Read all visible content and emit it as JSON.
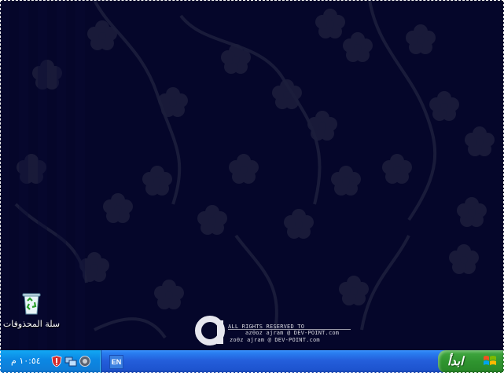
{
  "desktop": {
    "background_color": "#05062a",
    "pattern_color": "#2a2c48",
    "icons": [
      {
        "name": "recycle-bin",
        "label": "سلة المحذوفات"
      }
    ]
  },
  "wallpaper_logo": {
    "mark": "a",
    "lines": [
      "ALL RIGHTS RESERVED TO",
      "az0oz ajram @ DEV-POINT.com",
      "zo0z ajram @ DEV-POINT.com"
    ]
  },
  "taskbar": {
    "start_label": "ابدأ",
    "language_indicator": "EN",
    "clock": "١٠:٥٤ م",
    "tray_icons": [
      "security-shield-icon",
      "network-icon",
      "speaker-icon"
    ],
    "colors": {
      "bar": "#245edb",
      "tray": "#0b88e4",
      "start": "#2f942f"
    }
  }
}
